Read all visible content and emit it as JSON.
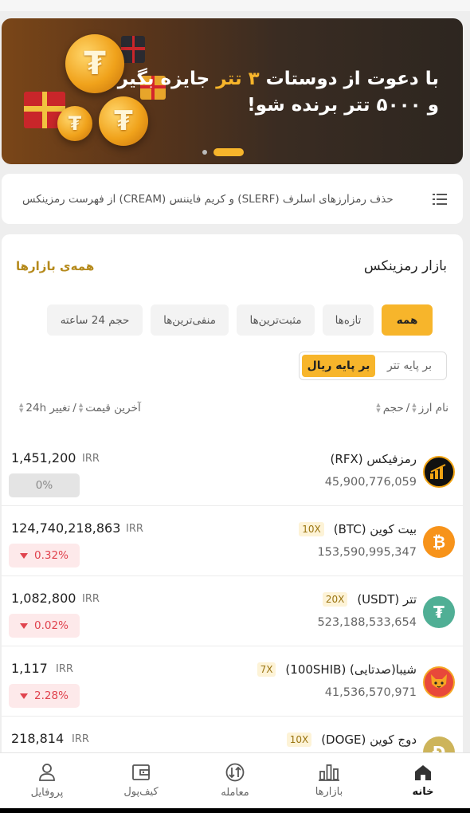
{
  "banner": {
    "line1_prefix": "با دعوت از دوستات",
    "line1_highlight": "۳ تتر",
    "line1_suffix": "جایزه بگیر",
    "line2": "و ۵۰۰۰ تتر برنده شو!",
    "coin_symbol": "₮",
    "accent_color": "#f7b52b"
  },
  "announcement": {
    "text": "حذف رمزارزهای اسلرف (SLERF) و کریم فایننس (CREAM) از فهرست رمزینکس",
    "icon": "list-icon"
  },
  "market": {
    "title": "بازار رمزینکس",
    "all_link": "همه‌ی بازارها",
    "filters": [
      "همه",
      "تازه‌ها",
      "مثبت‌ترین‌ها",
      "منفی‌ترین‌ها",
      "حجم 24 ساعته"
    ],
    "active_filter": "همه",
    "base_toggle": {
      "on": "بر پایه ریال",
      "off": "بر پایه تتر"
    },
    "columns": {
      "name": "نام ارز",
      "volume": "حجم",
      "last_price": "آخرین قیمت",
      "change": "تغییر 24h"
    },
    "rows": [
      {
        "name": "رمزفیکس (RFX)",
        "leverage": "",
        "volume": "45,900,776,059",
        "price": "1,451,200",
        "unit": "IRR",
        "change": "0%",
        "direction": "neutral",
        "icon": "rfx-logo"
      },
      {
        "name": "بیت کوین (BTC)",
        "leverage": "10X",
        "volume": "153,590,995,347",
        "price": "124,740,218,863",
        "unit": "IRR",
        "change": "0.32%",
        "direction": "down",
        "icon": "btc-logo"
      },
      {
        "name": "تتر (USDT)",
        "leverage": "20X",
        "volume": "523,188,533,654",
        "price": "1,082,800",
        "unit": "IRR",
        "change": "0.02%",
        "direction": "down",
        "icon": "usdt-logo"
      },
      {
        "name": "شیبا(صدتایی) (100SHIB)",
        "leverage": "7X",
        "volume": "41,536,570,971",
        "price": "1,117",
        "unit": "IRR",
        "change": "2.28%",
        "direction": "down",
        "icon": "shib-logo"
      },
      {
        "name": "دوج کوین (DOGE)",
        "leverage": "10X",
        "volume": "",
        "price": "218,814",
        "unit": "IRR",
        "change": "",
        "direction": "down",
        "icon": "doge-logo"
      }
    ],
    "colors": {
      "negative": "#e0434e",
      "neutral": "#888888",
      "link": "#b58a1c"
    }
  },
  "nav": {
    "items": [
      {
        "label": "خانه",
        "icon": "home-icon",
        "active": true
      },
      {
        "label": "بازارها",
        "icon": "bar-chart-icon",
        "active": false
      },
      {
        "label": "معامله",
        "icon": "exchange-icon",
        "active": false
      },
      {
        "label": "کیف‌پول",
        "icon": "wallet-icon",
        "active": false
      },
      {
        "label": "پروفایل",
        "icon": "user-icon",
        "active": false
      }
    ]
  }
}
